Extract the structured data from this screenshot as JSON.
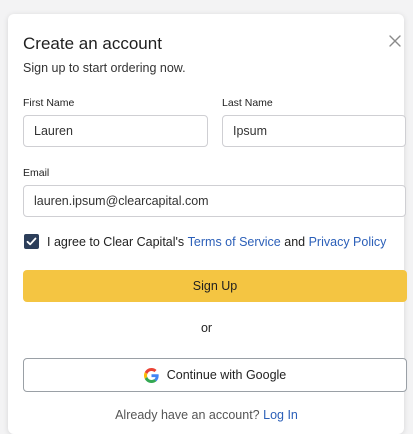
{
  "modal": {
    "title": "Create an account",
    "subtitle": "Sign up to start ordering now."
  },
  "form": {
    "first_name": {
      "label": "First Name",
      "value": "Lauren"
    },
    "last_name": {
      "label": "Last Name",
      "value": "Ipsum"
    },
    "email": {
      "label": "Email",
      "value": "lauren.ipsum@clearcapital.com"
    },
    "agree": {
      "checked": true,
      "prefix": "I agree to Clear Capital's ",
      "terms_link": "Terms of Service",
      "and": " and ",
      "privacy_link": "Privacy Policy"
    },
    "submit_label": "Sign Up"
  },
  "divider_text": "or",
  "google": {
    "label": "Continue with Google",
    "icon": "google-icon"
  },
  "footer": {
    "text": "Already have an account? ",
    "link": "Log In"
  },
  "colors": {
    "primary_button": "#f4c542",
    "link": "#2b5fb8",
    "checkbox": "#2c3e5a"
  }
}
